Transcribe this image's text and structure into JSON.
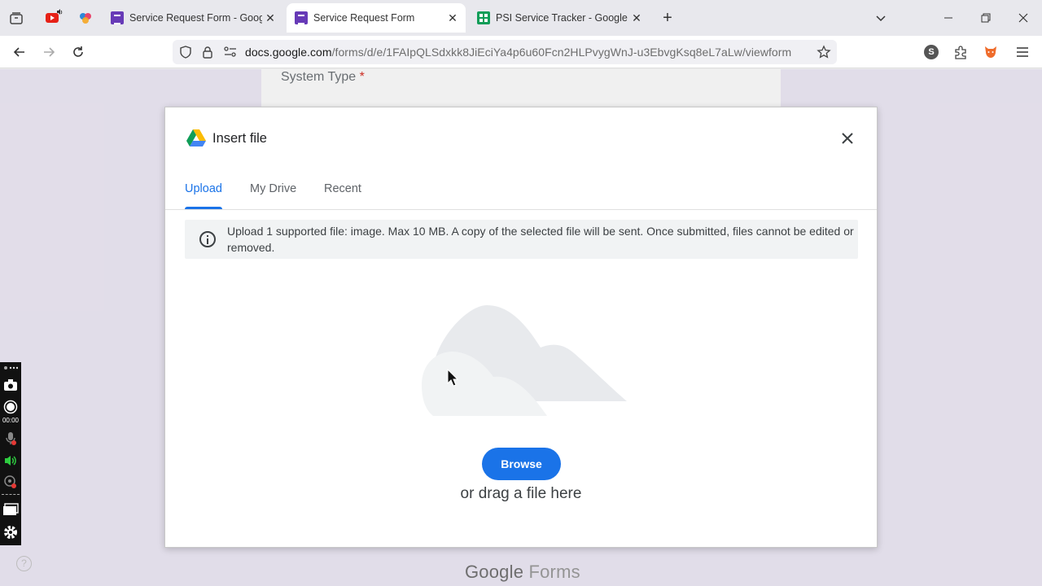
{
  "browser": {
    "tabs": [
      {
        "title": "Service Request Form - Google",
        "active": false
      },
      {
        "title": "Service Request Form",
        "active": true
      },
      {
        "title": "PSI Service Tracker - Google She",
        "active": false
      }
    ],
    "new_tab_symbol": "+",
    "url_host": "docs.google.com",
    "url_path": "/forms/d/e/1FAIpQLSdxkk8JiEciYa4p6u60Fcn2HLPvygWnJ-u3EbvgKsq8eL7aLw/viewform",
    "profile_letter": "S"
  },
  "form": {
    "question_label": "System Type",
    "required_mark": "*",
    "footer_brand_google": "Google",
    "footer_brand_forms": "Forms",
    "help_symbol": "?"
  },
  "recorder": {
    "timer": "00:00"
  },
  "dialog": {
    "title": "Insert file",
    "tabs": [
      "Upload",
      "My Drive",
      "Recent"
    ],
    "info_text": "Upload 1 supported file: image. Max 10 MB. A copy of the selected file will be sent. Once submitted, files cannot be edited or removed.",
    "browse_label": "Browse",
    "drag_text": "or drag a file here"
  },
  "colors": {
    "accent": "#1a73e8",
    "forms_purple": "#673ab7",
    "sheets_green": "#0f9d58"
  }
}
